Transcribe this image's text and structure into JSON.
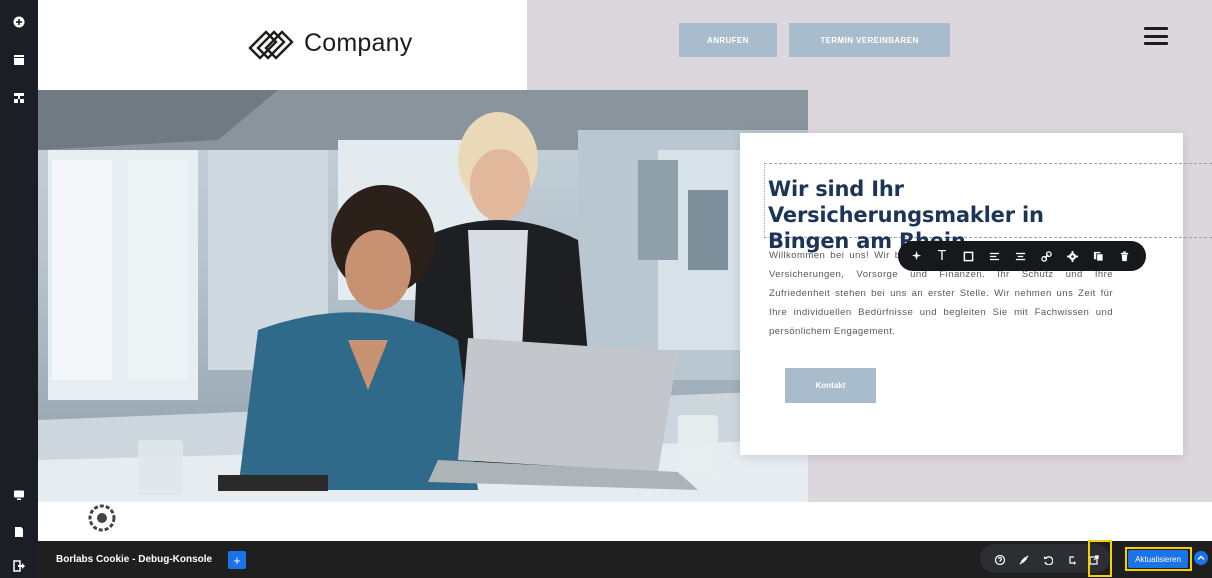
{
  "header": {
    "logo_text": "Company",
    "call_button": "ANRUFEN",
    "appointment_button": "TERMIN VEREINBAREN"
  },
  "hero": {
    "headline": "Wir sind Ihr Versicherungsmakler in Bingen am Rhein",
    "body": "Willkommen bei uns! Wir bieten Ihnen maßgeschneiderte Lösungen für Versicherungen, Vorsorge und Finanzen. Ihr Schutz und Ihre Zufriedenheit stehen bei uns an erster Stelle. Wir nehmen uns Zeit für Ihre individuellen Bedürfnisse und begleiten Sie mit Fachwissen und persönlichem Engagement.",
    "contact_button": "Kontakt"
  },
  "text_toolbar": {
    "text_glyph": "T"
  },
  "debug_bar": {
    "title": "Borlabs Cookie - Debug-Konsole",
    "plus": "+",
    "update_button": "Aktualisieren"
  },
  "colors": {
    "accent_blue": "#1a73e8",
    "button_blue_grey": "#a8bccc",
    "headline_navy": "#1c3557",
    "highlight_yellow": "#f6d100",
    "header_right_bg": "#dcd7dc"
  },
  "icons": {
    "left_bar": [
      "plus-circle-icon",
      "layout-icon",
      "structure-icon",
      "desktop-preview-icon",
      "page-icon",
      "exit-icon"
    ],
    "text_toolbar": [
      "ai-sparkle-icon",
      "text-icon",
      "box-icon",
      "align-left-icon",
      "align-center-icon",
      "link-icon",
      "gear-icon",
      "copy-icon",
      "trash-icon"
    ],
    "action_bar": [
      "help-icon",
      "brush-off-icon",
      "undo-icon",
      "redo-icon",
      "external-open-icon",
      "chevron-up-icon"
    ]
  }
}
